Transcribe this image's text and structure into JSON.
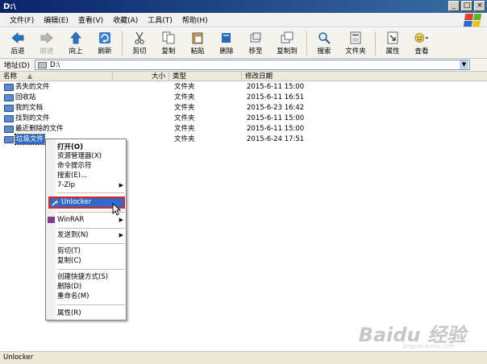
{
  "window": {
    "title": "D:\\",
    "min": "_",
    "max": "□",
    "close": "×"
  },
  "menubar": [
    {
      "label": "文件(F)"
    },
    {
      "label": "编辑(E)"
    },
    {
      "label": "查看(V)"
    },
    {
      "label": "收藏(A)"
    },
    {
      "label": "工具(T)"
    },
    {
      "label": "帮助(H)"
    }
  ],
  "toolbar": {
    "back": "后退",
    "forward": "前进",
    "up": "向上",
    "refresh": "刷新",
    "cut": "剪切",
    "copy": "复制",
    "paste": "粘贴",
    "delete": "删除",
    "move_to": "移至",
    "copy_to": "复制到",
    "search": "搜索",
    "folders": "文件夹",
    "properties": "属性",
    "views": "查看"
  },
  "address": {
    "label": "地址(D)",
    "value": "D:\\"
  },
  "columns": {
    "name": "名称",
    "size": "大小",
    "type": "类型",
    "modified": "修改日期"
  },
  "rows": [
    {
      "name": "丢失的文件",
      "type": "文件夹",
      "date": "2015-6-11 15:00"
    },
    {
      "name": "回收站",
      "type": "文件夹",
      "date": "2015-6-11 16:51"
    },
    {
      "name": "我的文档",
      "type": "文件夹",
      "date": "2015-6-23 16:42"
    },
    {
      "name": "找到的文件",
      "type": "文件夹",
      "date": "2015-6-11 15:00"
    },
    {
      "name": "最近删除的文件",
      "type": "文件夹",
      "date": "2015-6-11 15:00"
    },
    {
      "name": "垃圾文件",
      "type": "文件夹",
      "date": "2015-6-24 17:51"
    }
  ],
  "context_menu": {
    "open": "打开(O)",
    "explorer": "资源管理器(X)",
    "cmd": "命令提示符",
    "search": "搜索(E)...",
    "sevenzip": "7-Zip",
    "unlocker": "Unlocker",
    "winrar": "WinRAR",
    "send_to": "发送到(N)",
    "cut": "剪切(T)",
    "copy": "复制(C)",
    "shortcut": "创建快捷方式(S)",
    "delete": "删除(D)",
    "rename": "重命名(M)",
    "properties": "属性(R)"
  },
  "status": "Unlocker",
  "watermark": {
    "main": "Baidu 经验",
    "sub": "jingyan.baidu.com"
  }
}
